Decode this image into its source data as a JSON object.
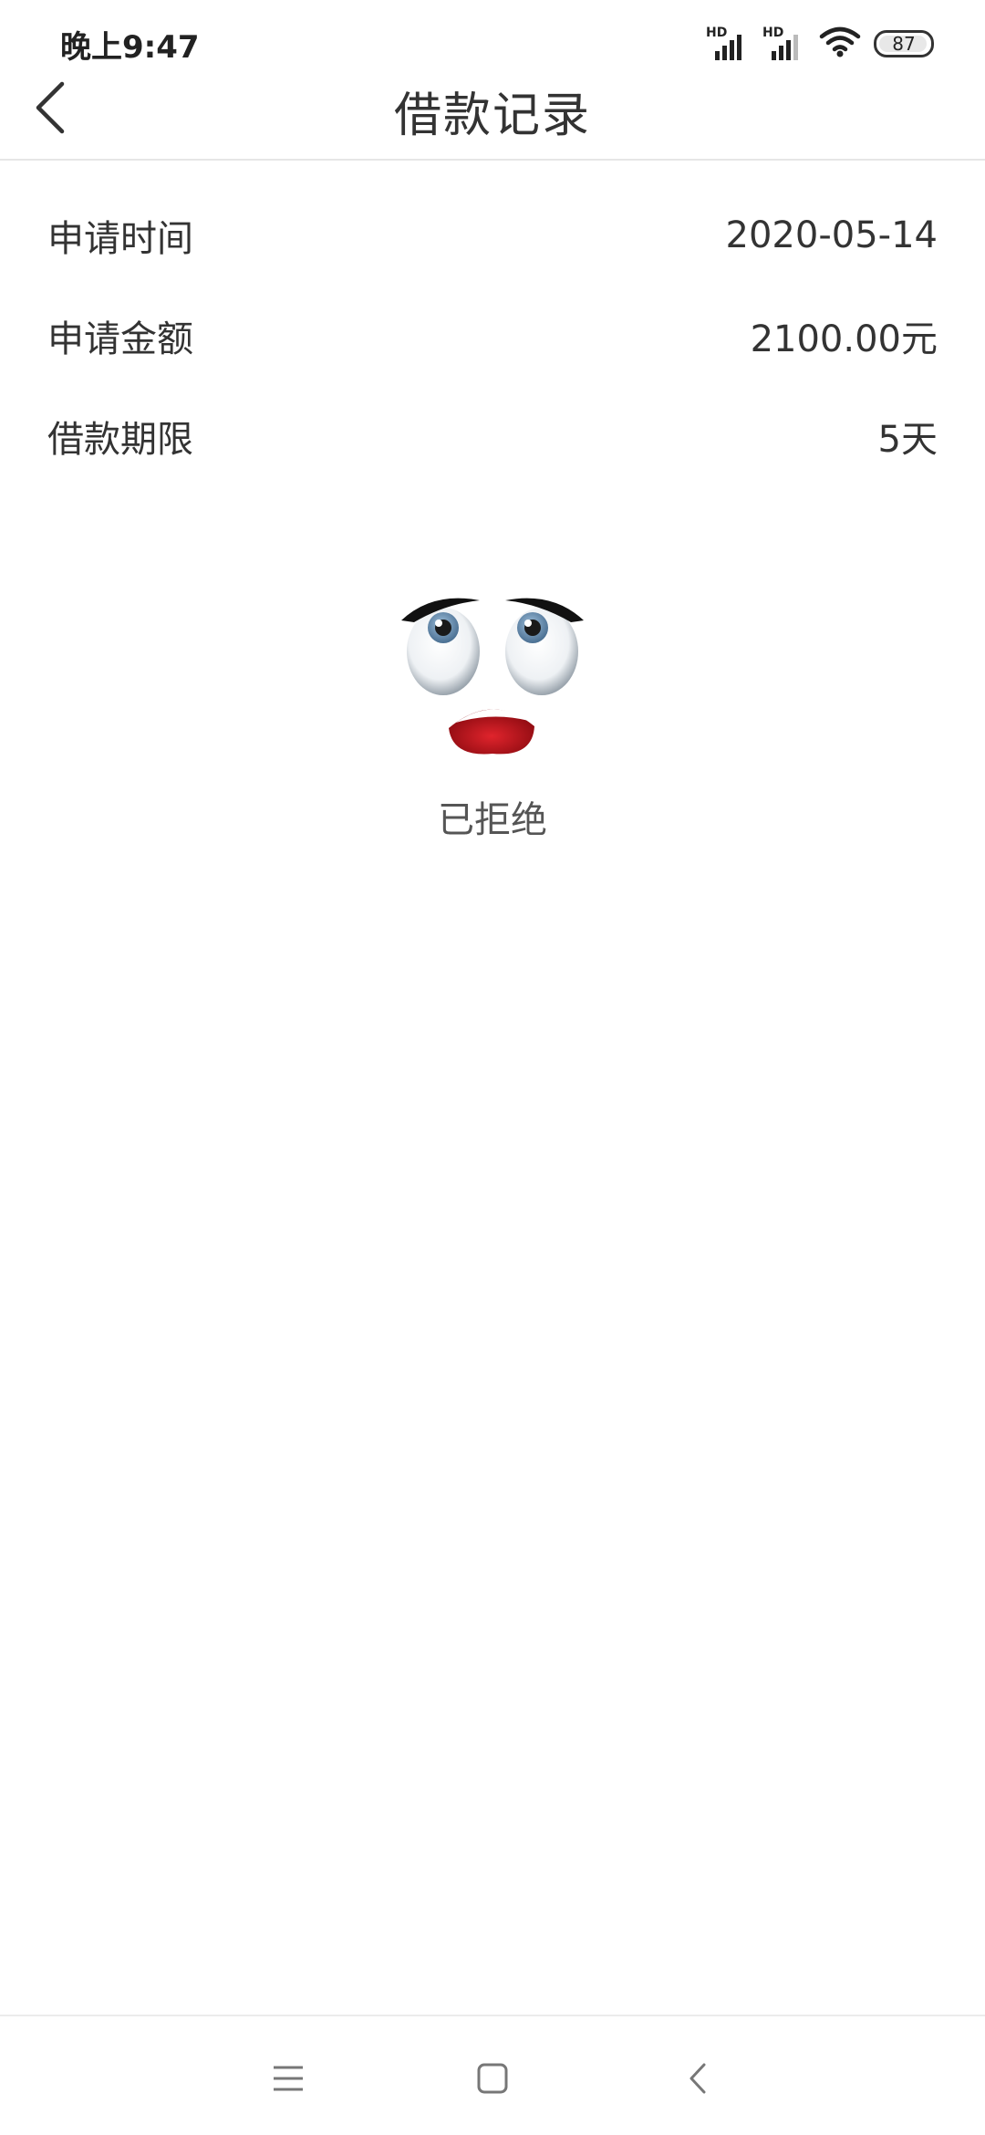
{
  "status_bar": {
    "time": "晚上9:47",
    "signal1_label": "HD",
    "signal2_label": "HD",
    "battery_level": "87",
    "icons": [
      "signal-icon",
      "signal-icon",
      "wifi-icon",
      "battery-icon"
    ]
  },
  "header": {
    "title": "借款记录",
    "back_icon": "chevron-left-icon"
  },
  "details": [
    {
      "label": "申请时间",
      "value": "2020-05-14"
    },
    {
      "label": "申请金额",
      "value": "2100.00元"
    },
    {
      "label": "借款期限",
      "value": "5天"
    }
  ],
  "result": {
    "status": "已拒绝",
    "illustration": "sad-face-icon"
  },
  "system_nav": {
    "icons": [
      "menu-icon",
      "home-icon",
      "back-icon"
    ]
  },
  "colors": {
    "text": "#333333",
    "divider": "#e6e6e6",
    "status_text": "#555555",
    "mouth_red": "#c8141c"
  }
}
